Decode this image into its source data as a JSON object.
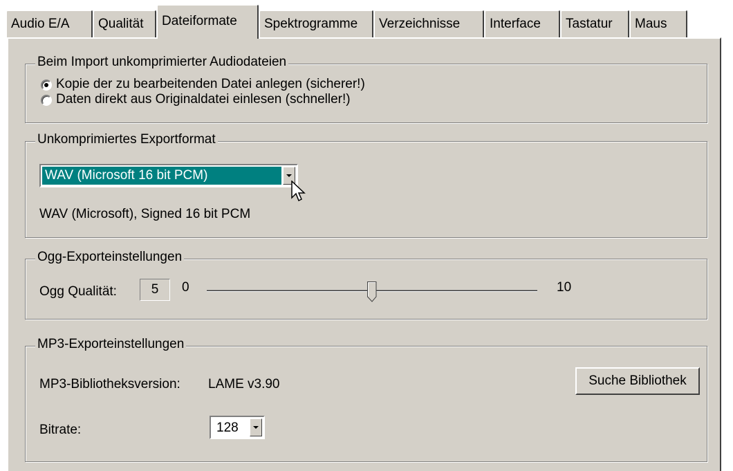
{
  "tabs": [
    {
      "label": "Audio E/A"
    },
    {
      "label": "Qualität"
    },
    {
      "label": "Dateiformate"
    },
    {
      "label": "Spektrogramme"
    },
    {
      "label": "Verzeichnisse"
    },
    {
      "label": "Interface"
    },
    {
      "label": "Tastatur"
    },
    {
      "label": "Maus"
    }
  ],
  "active_tab": "Dateiformate",
  "import_group": {
    "title": "Beim Import unkomprimierter Audiodateien",
    "options": [
      {
        "label": "Kopie der zu bearbeitenden Datei anlegen (sicherer!)",
        "selected": true
      },
      {
        "label": "Daten direkt aus Originaldatei einlesen (schneller!)",
        "selected": false
      }
    ]
  },
  "export_group": {
    "title": "Unkomprimiertes Exportformat",
    "selected_format": "WAV (Microsoft 16 bit PCM)",
    "description": "WAV (Microsoft), Signed 16 bit PCM"
  },
  "ogg_group": {
    "title": "Ogg-Exporteinstellungen",
    "quality_label": "Ogg Qualität:",
    "quality_value": "5",
    "min_label": "0",
    "max_label": "10",
    "slider_value": 5,
    "slider_min": 0,
    "slider_max": 10
  },
  "mp3_group": {
    "title": "MP3-Exporteinstellungen",
    "version_label": "MP3-Bibliotheksversion:",
    "version_value": "LAME v3.90",
    "find_button": "Suche Bibliothek",
    "bitrate_label": "Bitrate:",
    "bitrate_value": "128"
  },
  "colors": {
    "face": "#d4d0c8",
    "highlight": "#008080"
  }
}
